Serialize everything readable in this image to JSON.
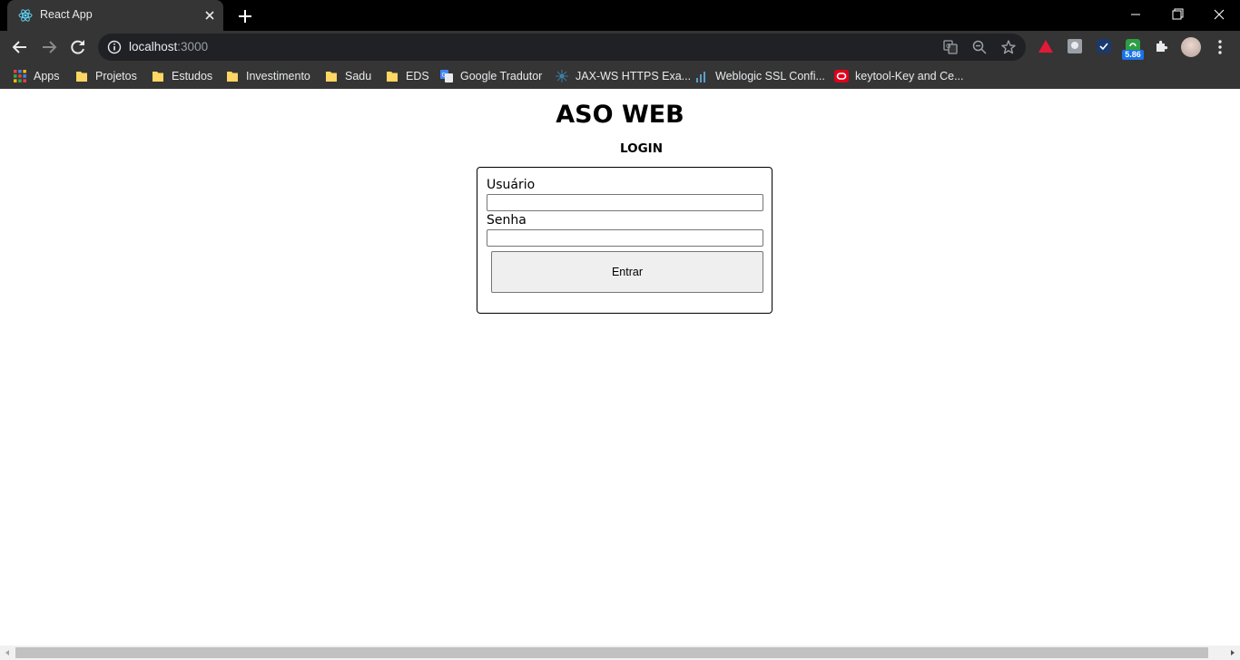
{
  "browser": {
    "tab_title": "React App",
    "url_host": "localhost",
    "url_port": ":3000",
    "extension_badge": "5.86",
    "bookmarks": [
      {
        "label": "Apps",
        "icon": "apps-grid-icon"
      },
      {
        "label": "Projetos",
        "icon": "folder-icon"
      },
      {
        "label": "Estudos",
        "icon": "folder-icon"
      },
      {
        "label": "Investimento",
        "icon": "folder-icon"
      },
      {
        "label": "Sadu",
        "icon": "folder-icon"
      },
      {
        "label": "EDS",
        "icon": "folder-icon"
      },
      {
        "label": "Google Tradutor",
        "icon": "google-translate-icon"
      },
      {
        "label": "JAX-WS HTTPS Exa...",
        "icon": "site-favicon-icon"
      },
      {
        "label": "Weblogic SSL Confi...",
        "icon": "site-favicon-icon"
      },
      {
        "label": "keytool-Key and Ce...",
        "icon": "oracle-icon"
      }
    ]
  },
  "page": {
    "title": "ASO WEB",
    "subtitle": "LOGIN",
    "form": {
      "user_label": "Usuário",
      "user_value": "",
      "password_label": "Senha",
      "password_value": "",
      "submit_label": "Entrar"
    }
  },
  "colors": {
    "browser_frame": "#000000",
    "toolbar": "#353535",
    "omnibox": "#202124",
    "page_background": "#ffffff"
  }
}
